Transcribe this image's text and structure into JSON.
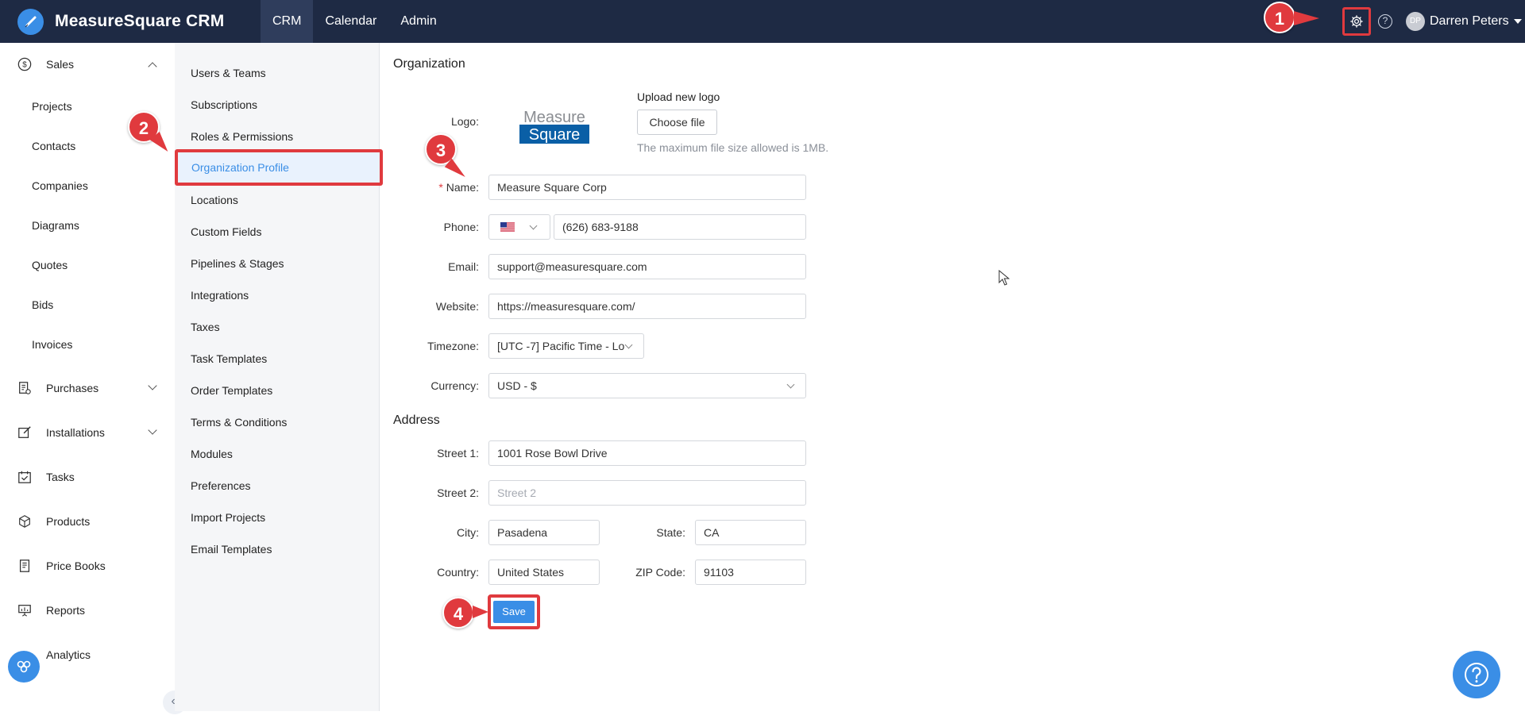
{
  "app": {
    "name": "MeasureSquare CRM",
    "nav": [
      "CRM",
      "Calendar",
      "Admin"
    ],
    "user": {
      "initials": "DP",
      "name": "Darren Peters"
    }
  },
  "sidebar": {
    "sales_label": "Sales",
    "sales_items": [
      "Projects",
      "Contacts",
      "Companies",
      "Diagrams",
      "Quotes",
      "Bids",
      "Invoices"
    ],
    "groups": [
      "Purchases",
      "Installations",
      "Tasks",
      "Products",
      "Price Books",
      "Reports",
      "Analytics"
    ],
    "collapse_icon": "«"
  },
  "settings_menu": {
    "items": [
      "Users & Teams",
      "Subscriptions",
      "Roles & Permissions",
      "Organization Profile",
      "Locations",
      "Custom Fields",
      "Pipelines & Stages",
      "Integrations",
      "Taxes",
      "Task Templates",
      "Order Templates",
      "Terms & Conditions",
      "Modules",
      "Preferences",
      "Import Projects",
      "Email Templates"
    ],
    "active": "Organization Profile"
  },
  "organization": {
    "title": "Organization",
    "logo_label": "Logo:",
    "logo_text_top": "Measure",
    "logo_text_bottom": "Square",
    "upload_title": "Upload new logo",
    "choose_file": "Choose file",
    "upload_hint": "The maximum file size allowed is 1MB.",
    "name_label": "Name:",
    "name_required": "*",
    "name_value": "Measure Square Corp",
    "phone_label": "Phone:",
    "phone_value": "(626) 683-9188",
    "email_label": "Email:",
    "email_value": "support@measuresquare.com",
    "website_label": "Website:",
    "website_value": "https://measuresquare.com/",
    "timezone_label": "Timezone:",
    "timezone_value": "[UTC -7] Pacific Time - Lo",
    "currency_label": "Currency:",
    "currency_value": "USD - $"
  },
  "address": {
    "title": "Address",
    "street1_label": "Street 1:",
    "street1_value": "1001 Rose Bowl Drive",
    "street2_label": "Street 2:",
    "street2_placeholder": "Street 2",
    "city_label": "City:",
    "city_value": "Pasadena",
    "state_label": "State:",
    "state_value": "CA",
    "country_label": "Country:",
    "country_value": "United States",
    "zip_label": "ZIP Code:",
    "zip_value": "91103",
    "save_label": "Save"
  },
  "annotations": [
    "1",
    "2",
    "3",
    "4"
  ],
  "colors": {
    "nav_bg": "#1e2a44",
    "accent": "#3a8ee6",
    "annotation": "#e03a3e"
  }
}
